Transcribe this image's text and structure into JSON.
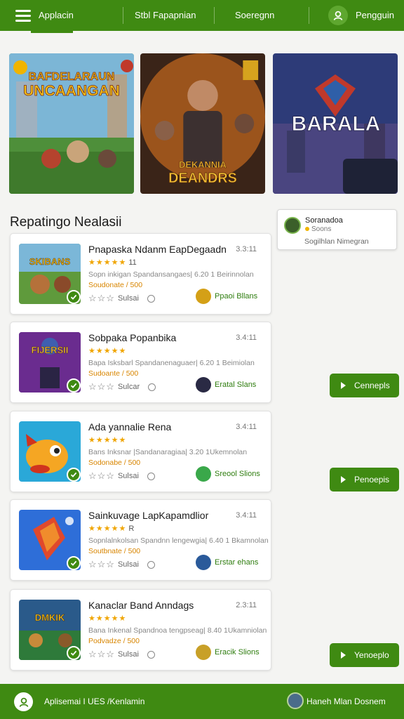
{
  "header": {
    "nav_items": [
      "Applacin",
      "Stbl Fapapnian",
      "Soeregnn",
      "Pengguin"
    ]
  },
  "banners": [
    {
      "title_line1": "BAFDELARAUN",
      "title_line2": "UNCAANGAN"
    },
    {
      "title_line1": "DEKANNIA",
      "title_line2": "DEANDRS"
    },
    {
      "title_line1": "BARALA",
      "title_line2": ""
    }
  ],
  "section": {
    "title": "Repatingo Nealasii"
  },
  "notification": {
    "name": "Soranadoa",
    "sub": "Soons",
    "message": "Sogilhlan Nimegran"
  },
  "apps": [
    {
      "title": "Pnapaska Ndanm EapDegaadn",
      "time": "3.3:11",
      "stars": "★★★★★",
      "rating_count": "11",
      "desc": "Sopn inkigan Spandansangaes| 6.20 1 Beirinnolan",
      "price": "Soudonate / 500",
      "rate_label": "Sulsai",
      "publisher": "Ppaoi Bllans",
      "thumb_text": "SKIBANS"
    },
    {
      "title": "Sobpaka Popanbika",
      "time": "3.4:11",
      "stars": "★★★★★",
      "rating_count": "",
      "desc": "Bapa Isksbarl Spandanenaguaer| 6.20 1 Beimiolan",
      "price": "Sudoante / 500",
      "rate_label": "Sulcar",
      "publisher": "Eratal Slans",
      "thumb_text": "FIJERSII"
    },
    {
      "title": "Ada yannalie Rena",
      "time": "3.4:11",
      "stars": "★★★★★",
      "rating_count": "",
      "desc": "Bans Inksnar |Sandanaragiaa| 3.20 1Ukemnolan",
      "price": "Sodonabe / 500",
      "rate_label": "Sulsai",
      "publisher": "Sreool Slions",
      "thumb_text": ""
    },
    {
      "title": "Sainkuvage LapKapamdlior",
      "time": "3.4:11",
      "stars": "★★★★★",
      "rating_count": "R",
      "desc": "Sopnlalnkolsan Spandnn lengewgia| 6.40 1 Bkamnolan",
      "price": "Soutbnate / 500",
      "rate_label": "Sulsai",
      "publisher": "Erstar ehans",
      "thumb_text": ""
    },
    {
      "title": "Kanaclar Band Anndags",
      "time": "2.3:11",
      "stars": "★★★★★",
      "rating_count": "",
      "desc": "Bana Inkenal Spandnoa tengpseag| 8.40 1Ukamniolan",
      "price": "Podvadze / 500",
      "rate_label": "Sulsai",
      "publisher": "Eracik Slions",
      "thumb_text": "DMKIK"
    }
  ],
  "side_buttons": [
    "Cennepls",
    "Penoepis",
    "Yenoeplo"
  ],
  "footer": {
    "left_text": "Aplisemai I UES /Kenlamin",
    "right_text": "Haneh Mlan Dosnem"
  },
  "colors": {
    "accent": "#3f8a12",
    "star": "#f0a500",
    "price": "#d88500"
  }
}
